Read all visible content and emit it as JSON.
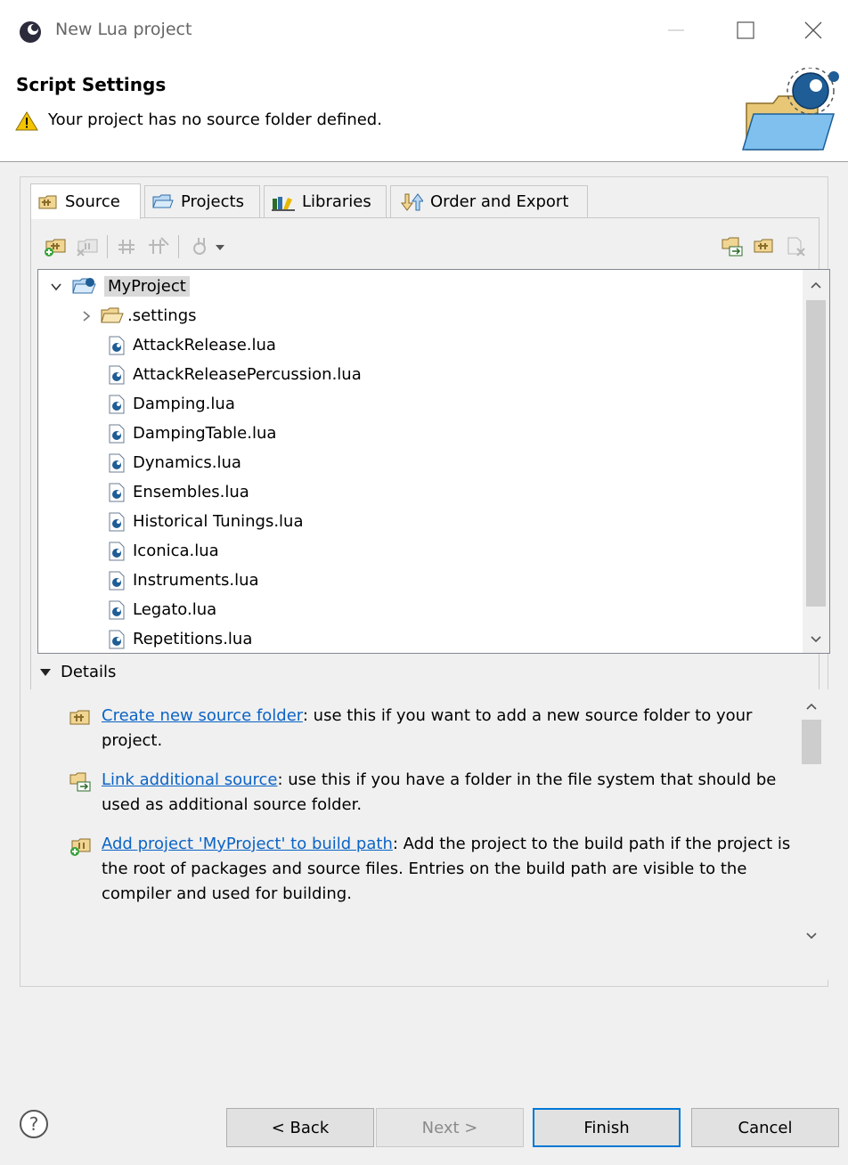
{
  "window": {
    "title": "New Lua project"
  },
  "header": {
    "title": "Script Settings",
    "message": "Your project has no source folder defined."
  },
  "tabs": [
    {
      "label": "Source",
      "icon": "source-folder-icon",
      "active": true
    },
    {
      "label": "Projects",
      "icon": "projects-folder-icon",
      "active": false
    },
    {
      "label": "Libraries",
      "icon": "libraries-icon",
      "active": false
    },
    {
      "label": "Order and Export",
      "icon": "order-export-icon",
      "active": false
    }
  ],
  "toolbar": {
    "left_icons": [
      "add-source-folder-icon",
      "remove-source-folder-icon",
      "add-build-path-icon",
      "remove-build-path-icon",
      "configure-icon",
      "dropdown-arrow-icon"
    ],
    "right_icons": [
      "link-source-icon",
      "new-source-folder-icon",
      "remove-icon"
    ]
  },
  "tree": {
    "root": "MyProject",
    "folder": ".settings",
    "files": [
      "AttackRelease.lua",
      "AttackReleasePercussion.lua",
      "Damping.lua",
      "DampingTable.lua",
      "Dynamics.lua",
      "Ensembles.lua",
      "Historical Tunings.lua",
      "Iconica.lua",
      "Instruments.lua",
      "Legato.lua",
      "Repetitions.lua"
    ]
  },
  "details": {
    "label": "Details",
    "items": [
      {
        "link": "Create new source folder",
        "text": ": use this if you want to add a new source folder to your project."
      },
      {
        "link": "Link additional source",
        "text": ": use this if you have a folder in the file system that should be used as additional source folder."
      },
      {
        "link": "Add project 'MyProject' to build path",
        "text": ": Add the project to the build path if the project is the root of packages and source files. Entries on the build path are visible to the compiler and used for building."
      }
    ]
  },
  "buttons": {
    "back": "< Back",
    "next": "Next >",
    "finish": "Finish",
    "cancel": "Cancel"
  },
  "colors": {
    "link": "#0b63c5",
    "default_button_border": "#0078d7",
    "warning": "#f5c400"
  }
}
